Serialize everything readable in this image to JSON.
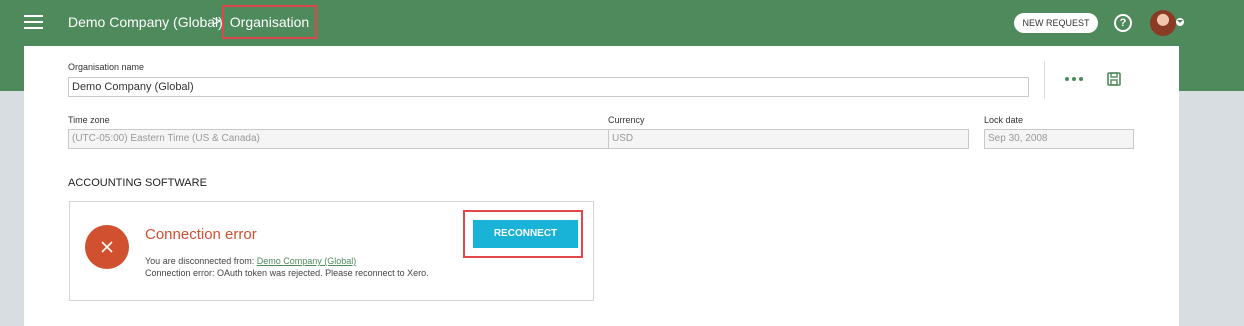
{
  "header": {
    "company": "Demo Company (Global)",
    "separator": ">",
    "current_page": "Organisation",
    "new_request_label": "NEW REQUEST",
    "help_glyph": "?",
    "colors": {
      "bar": "#4e8a5b",
      "highlight": "#e0464a"
    }
  },
  "form": {
    "org_name_label": "Organisation name",
    "org_name_value": "Demo Company (Global)",
    "timezone_label": "Time zone",
    "timezone_value": "(UTC-05:00) Eastern Time (US & Canada)",
    "currency_label": "Currency",
    "currency_value": "USD",
    "lockdate_label": "Lock date",
    "lockdate_value": "Sep 30, 2008"
  },
  "accounting": {
    "section_title": "ACCOUNTING SOFTWARE",
    "error_title": "Connection error",
    "disconnected_prefix": "You are disconnected from: ",
    "disconnected_link": "Demo Company (Global)",
    "error_message": "Connection error: OAuth token was rejected. Please reconnect to Xero.",
    "reconnect_label": "RECONNECT",
    "colors": {
      "error": "#d0502f",
      "button": "#1ab3d8"
    }
  }
}
